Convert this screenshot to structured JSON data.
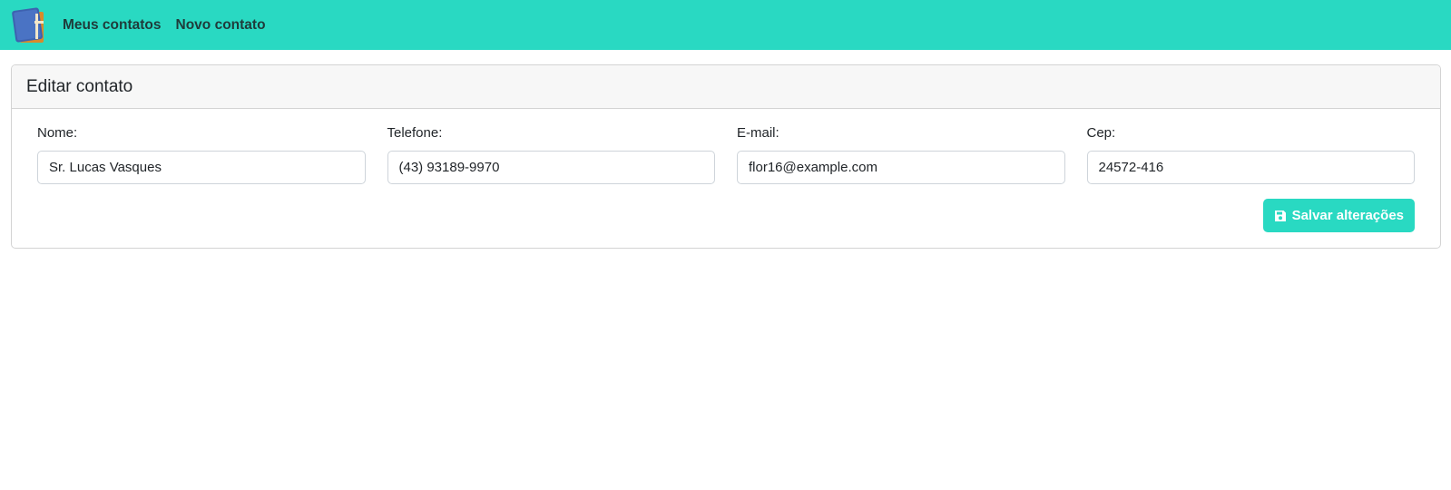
{
  "navbar": {
    "logo_icon": "address-book-icon",
    "links": [
      "Meus contatos",
      "Novo contato"
    ],
    "background": "#29d9c2"
  },
  "card": {
    "title": "Editar contato"
  },
  "form": {
    "fields": [
      {
        "label": "Nome:",
        "value": "Sr. Lucas Vasques"
      },
      {
        "label": "Telefone:",
        "value": "(43) 93189-9970"
      },
      {
        "label": "E-mail:",
        "value": "flor16@example.com"
      },
      {
        "label": "Cep:",
        "value": "24572-416"
      }
    ],
    "save_label": "Salvar alterações",
    "save_icon": "floppy-disk-icon"
  }
}
